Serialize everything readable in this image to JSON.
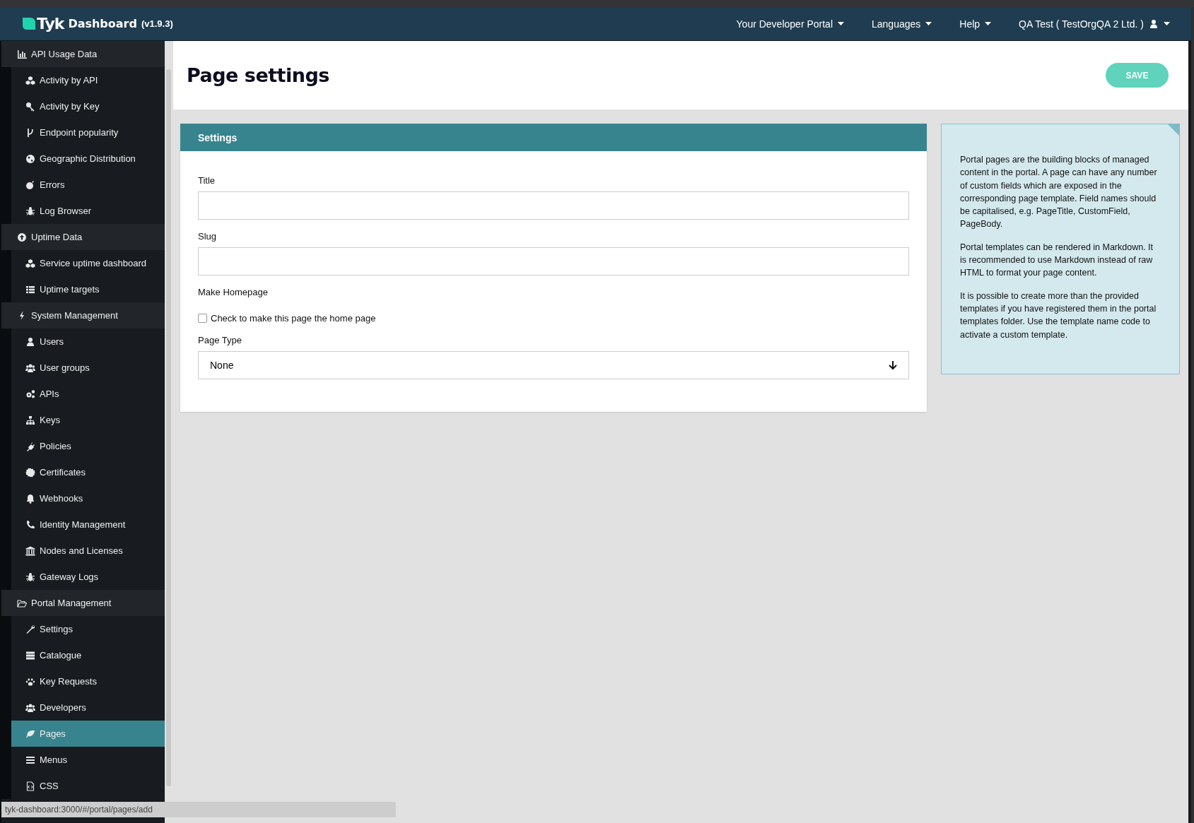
{
  "navbar": {
    "brand": "Tyk",
    "product": "Dashboard",
    "version": "(v1.9.3)",
    "menus": [
      {
        "label": "Your Developer Portal"
      },
      {
        "label": "Languages"
      },
      {
        "label": "Help"
      }
    ],
    "user": "QA Test ( TestOrgQA 2 Ltd. )"
  },
  "sidebar": {
    "groups": [
      {
        "label": "API Usage Data",
        "children": [
          {
            "label": "Activity by API",
            "selected": false
          },
          {
            "label": "Activity by Key",
            "selected": false
          },
          {
            "label": "Endpoint popularity",
            "selected": false
          },
          {
            "label": "Geographic Distribution",
            "selected": false
          },
          {
            "label": "Errors",
            "selected": false
          },
          {
            "label": "Log Browser",
            "selected": false
          }
        ]
      },
      {
        "label": "Uptime Data",
        "children": [
          {
            "label": "Service uptime dashboard",
            "selected": false
          },
          {
            "label": "Uptime targets",
            "selected": false
          }
        ]
      },
      {
        "label": "System Management",
        "children": [
          {
            "label": "Users",
            "selected": false
          },
          {
            "label": "User groups",
            "selected": false
          },
          {
            "label": "APIs",
            "selected": false
          },
          {
            "label": "Keys",
            "selected": false
          },
          {
            "label": "Policies",
            "selected": false
          },
          {
            "label": "Certificates",
            "selected": false
          },
          {
            "label": "Webhooks",
            "selected": false
          },
          {
            "label": "Identity Management",
            "selected": false
          },
          {
            "label": "Nodes and Licenses",
            "selected": false
          },
          {
            "label": "Gateway Logs",
            "selected": false
          }
        ]
      },
      {
        "label": "Portal Management",
        "children": [
          {
            "label": "Settings",
            "selected": false
          },
          {
            "label": "Catalogue",
            "selected": false
          },
          {
            "label": "Key Requests",
            "selected": false
          },
          {
            "label": "Developers",
            "selected": false
          },
          {
            "label": "Pages",
            "selected": true
          },
          {
            "label": "Menus",
            "selected": false
          },
          {
            "label": "CSS",
            "selected": false
          }
        ]
      }
    ]
  },
  "page": {
    "title": "Page settings",
    "save_button": "SAVE"
  },
  "form": {
    "heading": "Settings",
    "fields": [
      {
        "kind": "text",
        "label": "Title"
      },
      {
        "kind": "text",
        "label": "Slug"
      },
      {
        "kind": "checkbox",
        "label": "Make Homepage",
        "option": "Check to make this page the home page",
        "checked": false
      },
      {
        "kind": "select",
        "label": "Page Type",
        "value": "None"
      }
    ]
  },
  "help": {
    "paragraphs": [
      "Portal pages are the building blocks of managed content in the portal. A page can have any number of custom fields which are exposed in the corresponding page template. Field names should be capitalised, e.g. PageTitle, CustomField, PageBody.",
      "Portal templates can be rendered in Markdown. It is recommended to use Markdown instead of raw HTML to format your page content.",
      "It is possible to create more than the provided templates if you have registered them in the portal templates folder. Use the template name code to activate a custom template."
    ]
  },
  "status_url": "tyk-dashboard:3000/#/portal/pages/add"
}
